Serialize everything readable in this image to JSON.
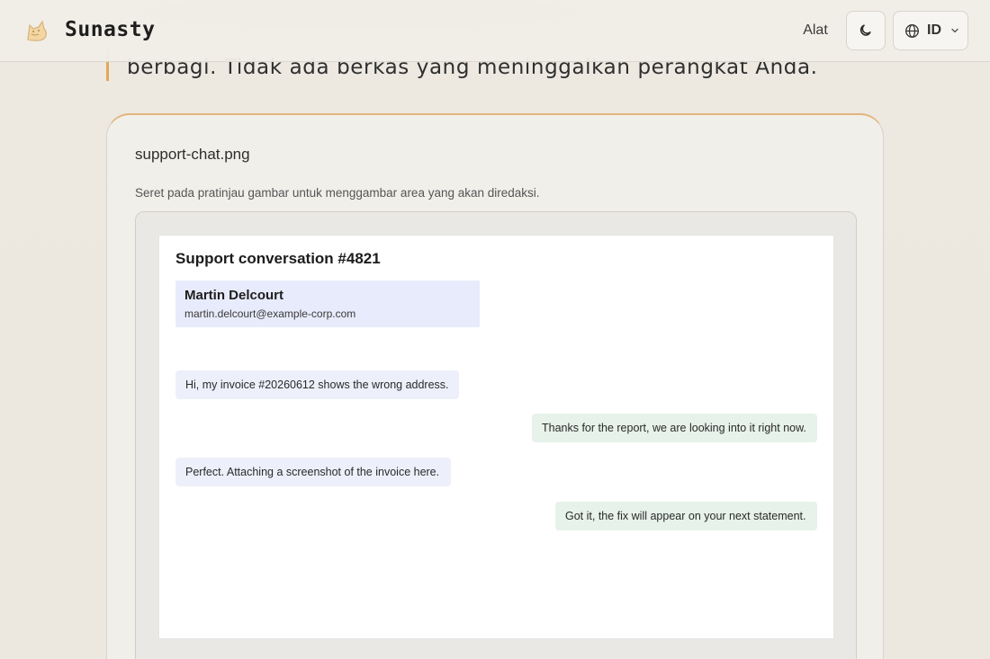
{
  "header": {
    "brand_name": "Sunasty",
    "logo_icon": "cat-logo-icon",
    "nav_tools_label": "Alat",
    "theme_toggle_icon": "moon-icon",
    "language": {
      "icon": "globe-icon",
      "code": "ID",
      "chevron_icon": "chevron-down-icon"
    }
  },
  "intro": {
    "text": "berbagi. Tidak ada berkas yang meninggalkan perangkat Anda."
  },
  "editor": {
    "file_name": "support-chat.png",
    "hint": "Seret pada pratinjau gambar untuk menggambar area yang akan diredaksi."
  },
  "preview": {
    "title": "Support conversation #4821",
    "contact": {
      "name": "Martin Delcourt",
      "email": "martin.delcourt@example-corp.com"
    },
    "messages": [
      {
        "side": "in",
        "text": "Hi, my invoice #20260612 shows the wrong address."
      },
      {
        "side": "out",
        "text": "Thanks for the report, we are looking into it right now."
      },
      {
        "side": "in",
        "text": "Perfect. Attaching a screenshot of the invoice here."
      },
      {
        "side": "out",
        "text": "Got it, the fix will appear on your next statement."
      }
    ]
  },
  "colors": {
    "accent": "#e0a85a",
    "page_background": "#ede9e1",
    "incoming_bubble": "#edf0fb",
    "outgoing_bubble": "#e6f2ea",
    "contact_highlight": "#e8ebfb"
  }
}
